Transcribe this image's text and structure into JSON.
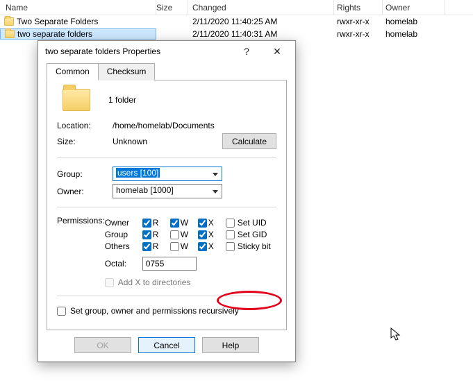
{
  "columns": {
    "name": "Name",
    "size": "Size",
    "changed": "Changed",
    "rights": "Rights",
    "owner": "Owner"
  },
  "rows": [
    {
      "name": "Two Separate Folders",
      "changed": "2/11/2020 11:40:25 AM",
      "rights": "rwxr-xr-x",
      "owner": "homelab",
      "selected": false
    },
    {
      "name": "two separate folders",
      "changed": "2/11/2020 11:40:31 AM",
      "rights": "rwxr-xr-x",
      "owner": "homelab",
      "selected": true
    }
  ],
  "dialog": {
    "title": "two separate folders Properties",
    "help_symbol": "?",
    "close_symbol": "✕",
    "tabs": {
      "common": "Common",
      "checksum": "Checksum"
    },
    "summary": "1 folder",
    "location": {
      "k": "Location:",
      "v": "/home/homelab/Documents"
    },
    "size": {
      "k": "Size:",
      "v": "Unknown"
    },
    "calculate": "Calculate",
    "group": {
      "k": "Group:",
      "v": "users [100]"
    },
    "owner": {
      "k": "Owner:",
      "v": "homelab [1000]"
    },
    "perm_label": "Permissions:",
    "perm_headers": {
      "owner": "Owner",
      "group": "Group",
      "others": "Others"
    },
    "perm_letters": {
      "r": "R",
      "w": "W",
      "x": "X"
    },
    "perm_extra": {
      "setuid": "Set UID",
      "setgid": "Set GID",
      "sticky": "Sticky bit"
    },
    "perms": {
      "owner": {
        "r": true,
        "w": true,
        "x": true,
        "extra": false
      },
      "group": {
        "r": true,
        "w": false,
        "x": true,
        "extra": false
      },
      "others": {
        "r": true,
        "w": false,
        "x": true,
        "extra": false
      }
    },
    "octal": {
      "k": "Octal:",
      "v": "0755"
    },
    "addx": "Add X to directories",
    "recursive": "Set group, owner and permissions recursively",
    "buttons": {
      "ok": "OK",
      "cancel": "Cancel",
      "help": "Help"
    }
  }
}
